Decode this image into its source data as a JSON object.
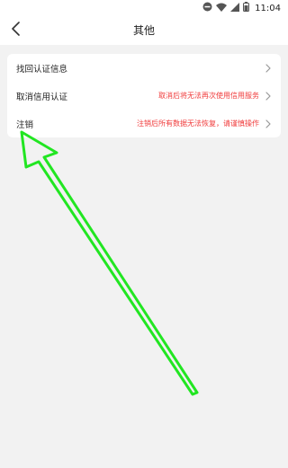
{
  "status_bar": {
    "time": "11:04",
    "icons": [
      "do-not-disturb-icon",
      "wifi-icon",
      "signal-icon",
      "battery-icon"
    ]
  },
  "header": {
    "title": "其他",
    "back_icon": "chevron-left-icon"
  },
  "settings": {
    "items": [
      {
        "label": "找回认证信息",
        "hint": ""
      },
      {
        "label": "取消信用认证",
        "hint": "取消后将无法再次使用信用服务"
      },
      {
        "label": "注销",
        "hint": "注销后所有数据无法恢复，请谨慎操作"
      }
    ]
  },
  "annotation": {
    "arrow_color": "#22e622",
    "icon": "green-arrow-icon"
  },
  "colors": {
    "hint_red": "#f03a3a",
    "background": "#f2f2f2"
  }
}
